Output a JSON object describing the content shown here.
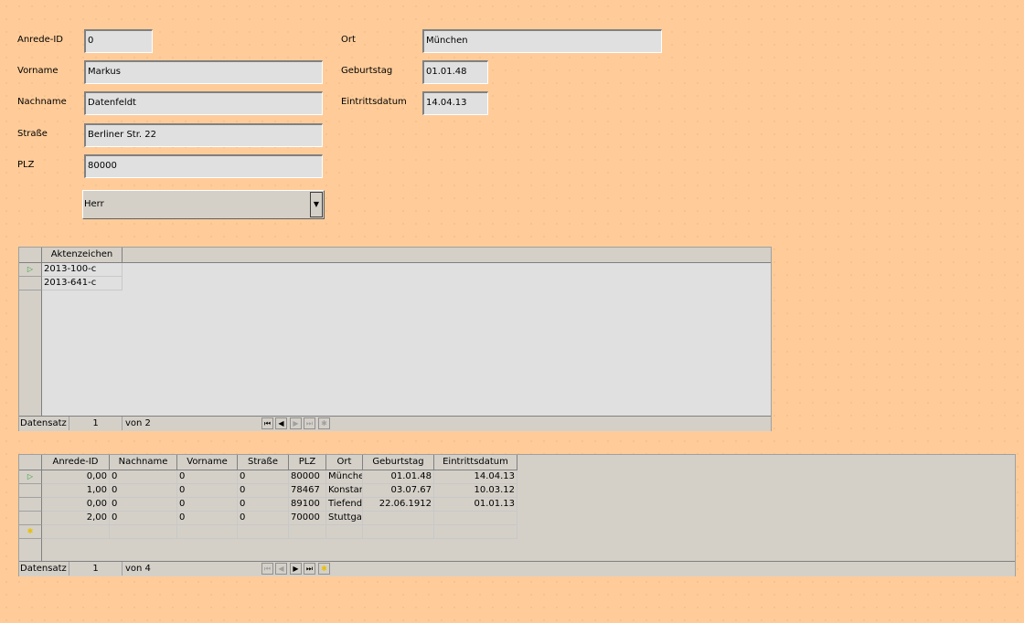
{
  "form": {
    "anrede_id": {
      "label": "Anrede-ID",
      "value": "0"
    },
    "vorname": {
      "label": "Vorname",
      "value": "Markus"
    },
    "nachname": {
      "label": "Nachname",
      "value": "Datenfeldt"
    },
    "strasse": {
      "label": "Straße",
      "value": "Berliner Str. 22"
    },
    "plz": {
      "label": "PLZ",
      "value": "80000"
    },
    "anrede": {
      "value": "Herr"
    },
    "ort": {
      "label": "Ort",
      "value": "München"
    },
    "geburtstag": {
      "label": "Geburtstag",
      "value": "01.01.48"
    },
    "eintrittsdatum": {
      "label": "Eintrittsdatum",
      "value": "14.04.13"
    }
  },
  "subgrid": {
    "columns": [
      "Aktenzeichen"
    ],
    "rows": [
      [
        "2013-100-c"
      ],
      [
        "2013-641-c"
      ]
    ],
    "nav": {
      "label": "Datensatz",
      "current": "1",
      "of": "von 2"
    }
  },
  "maingrid": {
    "columns": [
      "Anrede-ID",
      "Nachname",
      "Vorname",
      "Straße",
      "PLZ",
      "Ort",
      "Geburtstag",
      "Eintrittsdatum"
    ],
    "rows": [
      [
        "0,00",
        "0",
        "0",
        "0",
        "80000",
        "Münche",
        "01.01.48",
        "14.04.13"
      ],
      [
        "1,00",
        "0",
        "0",
        "0",
        "78467",
        "Konstar",
        "03.07.67",
        "10.03.12"
      ],
      [
        "0,00",
        "0",
        "0",
        "0",
        "89100",
        "Tiefend",
        "22.06.1912",
        "01.01.13"
      ],
      [
        "2,00",
        "0",
        "0",
        "0",
        "70000",
        "Stuttga",
        "",
        ""
      ]
    ],
    "nav": {
      "label": "Datensatz",
      "current": "1",
      "of": "von 4"
    }
  },
  "icons": {
    "current_row": "play-triangle-icon",
    "new_row": "asterisk-icon",
    "first": "first-record-icon",
    "prev": "prev-record-icon",
    "next": "next-record-icon",
    "last": "last-record-icon",
    "new": "new-record-icon"
  },
  "colors": {
    "background": "#ffcc99",
    "current_marker": "#2e9e2e",
    "new_marker": "#e8c000"
  }
}
